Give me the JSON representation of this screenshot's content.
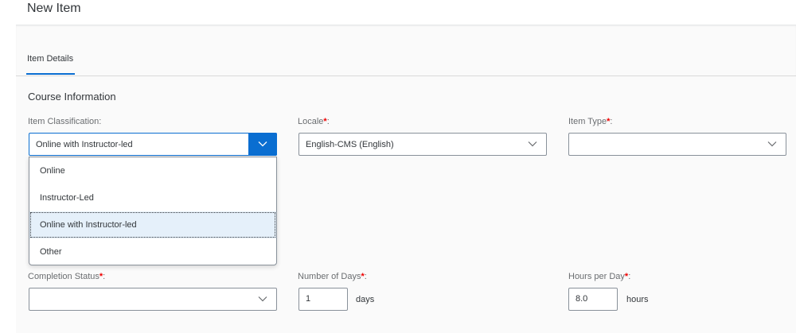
{
  "page": {
    "title": "New Item"
  },
  "tabs": [
    {
      "label": "Item Details"
    }
  ],
  "section": {
    "title": "Course Information"
  },
  "fields": {
    "item_classification": {
      "label": "Item Classification:",
      "value": "Online with Instructor-led",
      "options": [
        "Online",
        "Instructor-Led",
        "Online with Instructor-led",
        "Other"
      ],
      "selected_index": 2
    },
    "locale": {
      "label": "Locale",
      "required_mark": "*",
      "colon": ":",
      "value": "English-CMS (English)"
    },
    "item_type": {
      "label": "Item Type",
      "required_mark": "*",
      "colon": ":",
      "value": ""
    },
    "completion_status": {
      "label": "Completion Status",
      "required_mark": "*",
      "colon": ":",
      "value": ""
    },
    "number_of_days": {
      "label": "Number of Days",
      "required_mark": "*",
      "colon": ":",
      "value": "1",
      "unit": "days"
    },
    "hours_per_day": {
      "label": "Hours per Day",
      "required_mark": "*",
      "colon": ":",
      "value": "8.0",
      "unit": "hours"
    }
  },
  "colors": {
    "accent": "#0a6ed1",
    "required": "#e00000",
    "selected_bg": "#e5f0fa"
  },
  "icons": {
    "dropdown": "chevron-down-icon"
  }
}
